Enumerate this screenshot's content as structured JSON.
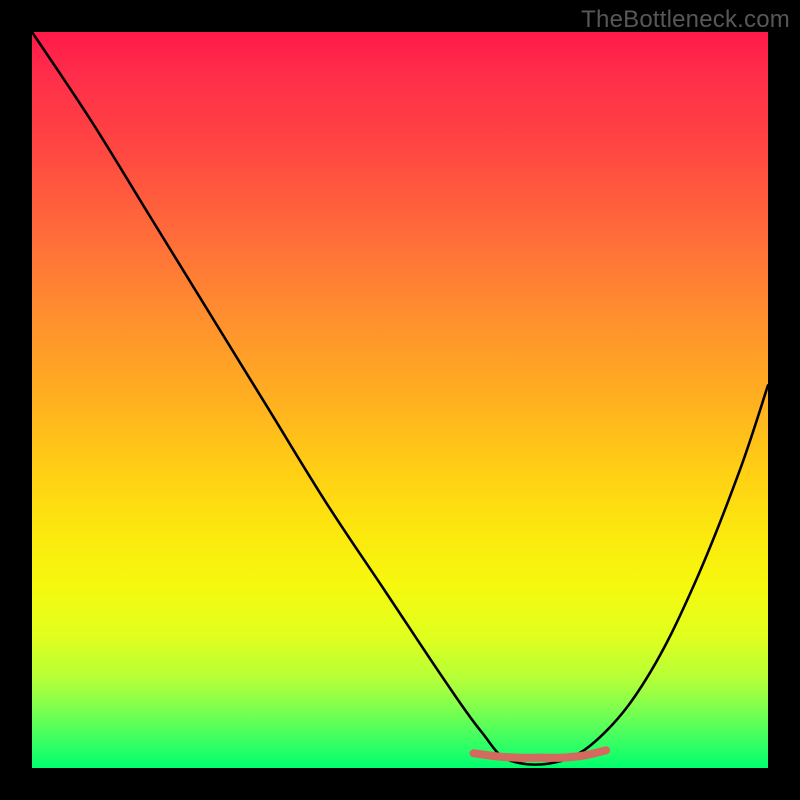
{
  "watermark": "TheBottleneck.com",
  "chart_data": {
    "type": "line",
    "title": "",
    "xlabel": "",
    "ylabel": "",
    "xlim": [
      0,
      100
    ],
    "ylim": [
      0,
      100
    ],
    "grid": false,
    "legend": false,
    "annotations": [],
    "series": [
      {
        "name": "curve",
        "x": [
          0,
          8,
          16,
          24,
          32,
          40,
          48,
          56,
          61,
          65,
          72,
          78,
          84,
          90,
          96,
          100
        ],
        "values": [
          100,
          88,
          75,
          62,
          49,
          36,
          24,
          12,
          5,
          1,
          1,
          5,
          13,
          25,
          40,
          52
        ]
      },
      {
        "name": "flat-segment",
        "x": [
          60,
          63,
          66,
          69,
          72,
          75,
          78
        ],
        "values": [
          2.0,
          1.6,
          1.4,
          1.4,
          1.4,
          1.7,
          2.4
        ]
      }
    ],
    "colors": {
      "curve_stroke": "#000000",
      "flat_segment_stroke": "#d46a5f",
      "gradient_top": "#ff194a",
      "gradient_bottom": "#00ff6e",
      "frame": "#000000",
      "watermark": "#575757"
    }
  }
}
